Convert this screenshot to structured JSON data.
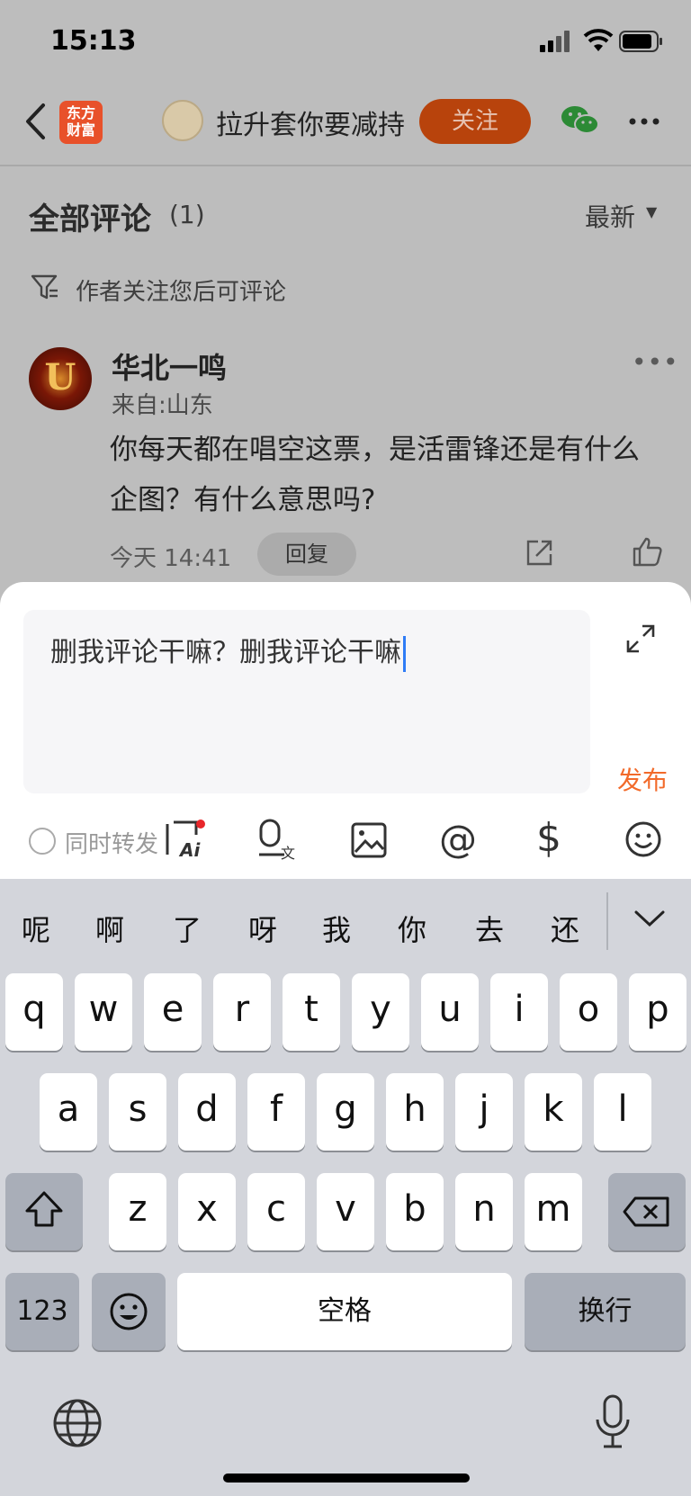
{
  "status_bar": {
    "time": "15:13"
  },
  "nav": {
    "logo_text_line1": "东方",
    "logo_text_line2": "财富",
    "author_name": "拉升套你要减持",
    "follow_label": "关注"
  },
  "comments": {
    "title": "全部评论",
    "count": "(1)",
    "sort_label": "最新",
    "sort_arrow": "▼",
    "notice": "作者关注您后可评论",
    "item": {
      "avatar_letter": "U",
      "name": "华北一鸣",
      "from": "来自:山东",
      "text": "你每天都在唱空这票，是活雷锋还是有什么企图？有什么意思吗?",
      "time": "今天 14:41",
      "reply_label": "回复",
      "more": "•••"
    }
  },
  "composer": {
    "input_value": "删我评论干嘛？删我评论干嘛",
    "publish_label": "发布",
    "repost_label": "同时转发",
    "tools": [
      "ai-ask-icon",
      "voice-to-text-icon",
      "image-icon",
      "mention-icon",
      "stock-dollar-icon",
      "emoji-icon"
    ],
    "ai_letters": "Ai",
    "mention_glyph": "@",
    "dollar_glyph": "$"
  },
  "keyboard": {
    "candidates": [
      "呢",
      "啊",
      "了",
      "呀",
      "我",
      "你",
      "去",
      "还"
    ],
    "row1": [
      "q",
      "w",
      "e",
      "r",
      "t",
      "y",
      "u",
      "i",
      "o",
      "p"
    ],
    "row2": [
      "a",
      "s",
      "d",
      "f",
      "g",
      "h",
      "j",
      "k",
      "l"
    ],
    "row3": [
      "z",
      "x",
      "c",
      "v",
      "b",
      "n",
      "m"
    ],
    "numbers_label": "123",
    "space_label": "空格",
    "return_label": "换行"
  },
  "colors": {
    "accent": "#f26a2a",
    "follow_bg": "#b8430c",
    "caret": "#2f7cf6",
    "wechat": "#2c8a35"
  }
}
